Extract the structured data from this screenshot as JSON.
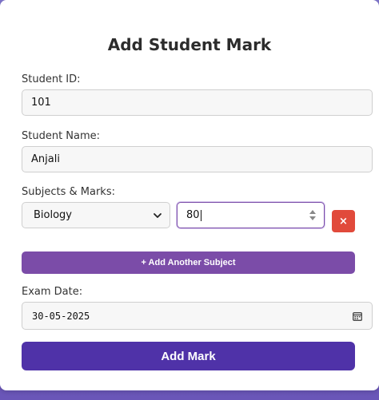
{
  "form": {
    "title": "Add Student Mark",
    "student_id": {
      "label": "Student ID:",
      "value": "101"
    },
    "student_name": {
      "label": "Student Name:",
      "value": "Anjali"
    },
    "subjects": {
      "label": "Subjects & Marks:",
      "rows": [
        {
          "subject": "Biology",
          "mark": "80"
        }
      ],
      "remove_icon": "×",
      "add_label": "+ Add Another Subject"
    },
    "exam_date": {
      "label": "Exam Date:",
      "value": "30-05-2025"
    },
    "submit_label": "Add Mark"
  },
  "icons": {
    "select": "chevron-down-icon",
    "spinner": "number-spinner-icon",
    "remove": "close-icon",
    "calendar": "calendar-icon"
  },
  "colors": {
    "primary": "#4f32a8",
    "secondary": "#7b4ca8",
    "danger": "#e14a3b",
    "background": "#7d74c9"
  }
}
